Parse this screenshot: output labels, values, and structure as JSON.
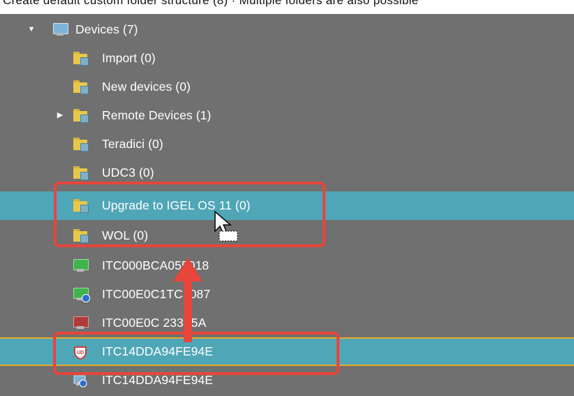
{
  "top_strip_text": "Create default custom folder structure (8)  ·  Multiple folders are also possible",
  "tree": {
    "root": {
      "label": "Devices (7)",
      "icon": "computer-monitor-icon",
      "expanded": true
    },
    "folders": [
      {
        "label": "Import (0)",
        "icon": "folder-icon"
      },
      {
        "label": "New devices (0)",
        "icon": "folder-icon"
      },
      {
        "label": "Remote Devices (1)",
        "icon": "folder-icon",
        "has_children": true
      },
      {
        "label": "Teradici (0)",
        "icon": "folder-icon"
      },
      {
        "label": "UDC3 (0)",
        "icon": "folder-icon"
      },
      {
        "label": "Upgrade to IGEL OS 11 (0)",
        "icon": "folder-icon",
        "state": "drop-target-highlighted"
      },
      {
        "label": "WOL (0)",
        "icon": "folder-icon"
      }
    ],
    "devices": [
      {
        "label": "ITC000BCA055018",
        "icon": "monitor-green-icon",
        "screen_color": "#3fb34a"
      },
      {
        "label": "ITC00E0C1TC5087",
        "icon": "monitor-green-info-icon",
        "screen_color": "#3fb34a"
      },
      {
        "label": "ITC00E0C 233F5A",
        "icon": "monitor-red-icon",
        "screen_color": "#b03a3a"
      },
      {
        "label": "ITC14DDA94FE94E",
        "icon": "igel-shield-icon",
        "state": "selected"
      },
      {
        "label": "ITC14DDA94FE94E",
        "icon": "wrench-monitor-icon"
      }
    ]
  },
  "colors": {
    "background": "#707070",
    "selection": "#4fa6b7",
    "selection_border": "#e9a92a",
    "annotation": "#e8453b",
    "folder": "#e8c74a"
  }
}
